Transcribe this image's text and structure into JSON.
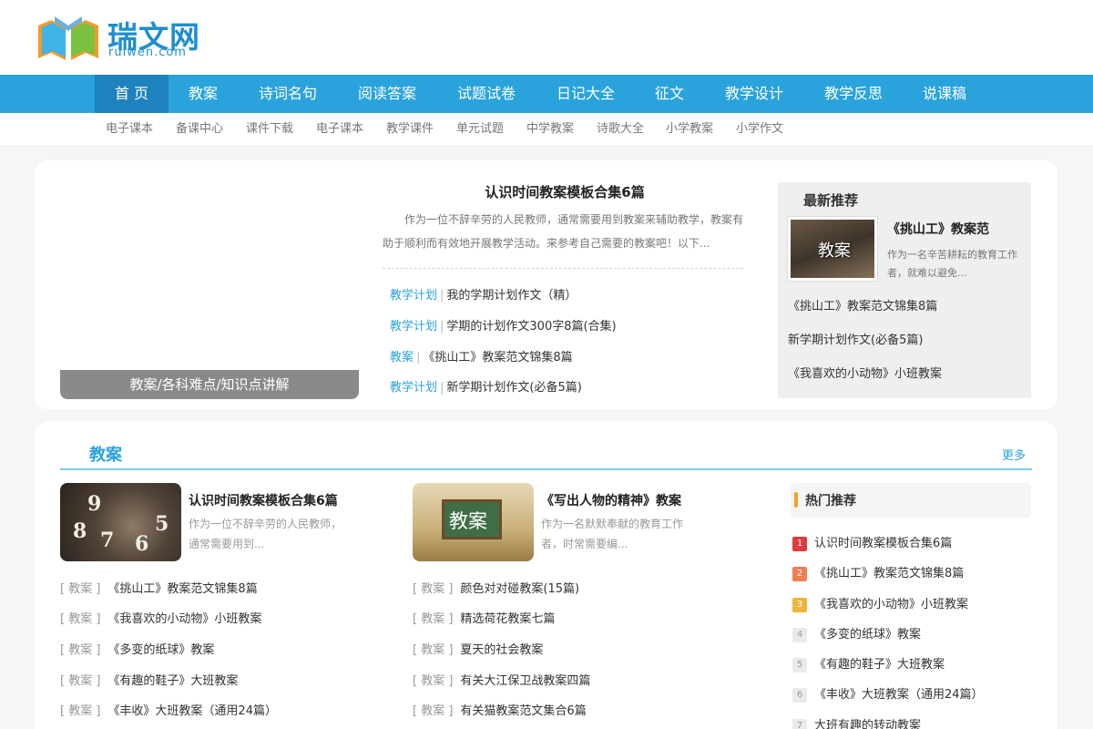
{
  "brand": {
    "name": "瑞文网",
    "domain": "ruiwen.com"
  },
  "nav": {
    "items": [
      "首 页",
      "教案",
      "诗词名句",
      "阅读答案",
      "试题试卷",
      "日记大全",
      "征文",
      "教学设计",
      "教学反思",
      "说课稿"
    ]
  },
  "subnav": {
    "items": [
      "电子课本",
      "备课中心",
      "课件下载",
      "电子课本",
      "教学课件",
      "单元试题",
      "中学教案",
      "诗歌大全",
      "小学教案",
      "小学作文"
    ]
  },
  "banner": {
    "caption": "教案/各科难点/知识点讲解"
  },
  "feature": {
    "title": "认识时间教案模板合集6篇",
    "desc": "作为一位不辞辛劳的人民教师，通常需要用到教案来辅助教学，教案有助于顺利而有效地开展教学活动。来参考自己需要的教案吧！以下...",
    "links": [
      {
        "cat": "教学计划",
        "sep": "|",
        "text": "我的学期计划作文（精）"
      },
      {
        "cat": "教学计划",
        "sep": "|",
        "text": "学期的计划作文300字8篇(合集)"
      },
      {
        "cat": "教案",
        "sep": "|",
        "text": "《挑山工》教案范文锦集8篇"
      },
      {
        "cat": "教学计划",
        "sep": "|",
        "text": "新学期计划作文(必备5篇)"
      }
    ]
  },
  "recommend": {
    "heading": "最新推荐",
    "thumb_text": "教案",
    "card_title": "《挑山工》教案范",
    "card_desc": "作为一名辛苦耕耘的教育工作者，就难以避免...",
    "links": [
      "《挑山工》教案范文锦集8篇",
      "新学期计划作文(必备5篇)",
      "《我喜欢的小动物》小班教案"
    ]
  },
  "section": {
    "title": "教案",
    "more": "更多",
    "card1": {
      "title": "认识时间教案模板合集6篇",
      "desc": "作为一位不辞辛劳的人民教师，通常需要用到..."
    },
    "card2": {
      "title": "《写出人物的精神》教案",
      "desc": "作为一名默默奉献的教育工作者，时常需要编...",
      "img_text": "教案"
    },
    "tag": "[ 教案 ]",
    "left_list": [
      "《挑山工》教案范文锦集8篇",
      "《我喜欢的小动物》小班教案",
      "《多变的纸球》教案",
      "《有趣的鞋子》大班教案",
      "《丰收》大班教案（通用24篇）"
    ],
    "mid_list": [
      "颜色对对碰教案(15篇)",
      "精选荷花教案七篇",
      "夏天的社会教案",
      "有关大江保卫战教案四篇",
      "有关猫教案范文集合6篇"
    ]
  },
  "hot": {
    "title": "热门推荐",
    "items": [
      {
        "rank": "1",
        "text": "认识时间教案模板合集6篇",
        "color": "#e0393e"
      },
      {
        "rank": "2",
        "text": "《挑山工》教案范文锦集8篇",
        "color": "#ef7e50"
      },
      {
        "rank": "3",
        "text": "《我喜欢的小动物》小班教案",
        "color": "#f0b43c"
      },
      {
        "rank": "4",
        "text": "《多变的纸球》教案",
        "color": ""
      },
      {
        "rank": "5",
        "text": "《有趣的鞋子》大班教案",
        "color": ""
      },
      {
        "rank": "6",
        "text": "《丰收》大班教案（通用24篇）",
        "color": ""
      },
      {
        "rank": "7",
        "text": "大班有趣的转动教案",
        "color": ""
      }
    ]
  },
  "colors": {
    "accent": "#2aa3dc",
    "nav_active": "#1d82bd",
    "hot_bar": "#f0a12b"
  }
}
